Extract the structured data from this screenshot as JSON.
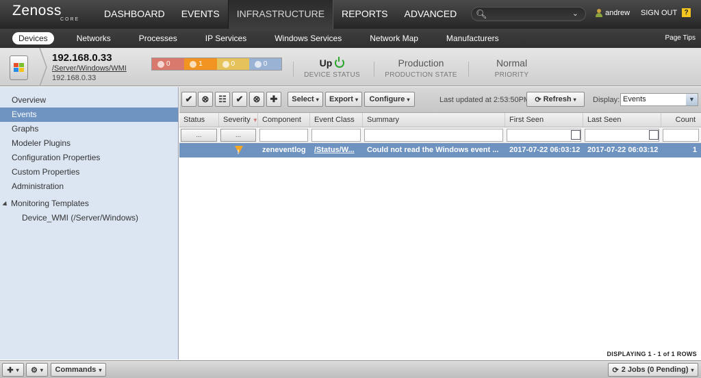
{
  "brand": {
    "name": "Zenoss",
    "sub": "CORE"
  },
  "nav": [
    {
      "label": "DASHBOARD",
      "active": false
    },
    {
      "label": "EVENTS",
      "active": false
    },
    {
      "label": "INFRASTRUCTURE",
      "active": true
    },
    {
      "label": "REPORTS",
      "active": false
    },
    {
      "label": "ADVANCED",
      "active": false
    }
  ],
  "user": {
    "name": "andrew",
    "signout": "SIGN OUT",
    "help": "?"
  },
  "subnav": {
    "items": [
      "Devices",
      "Networks",
      "Processes",
      "IP Services",
      "Windows Services",
      "Network Map",
      "Manufacturers"
    ],
    "active": "Devices",
    "page_tips": "Page Tips"
  },
  "device": {
    "ip": "192.168.0.33",
    "path": "/Server/Windows/WMI",
    "ip2": "192.168.0.33",
    "severity": [
      {
        "count": "0",
        "color": "#d9796e"
      },
      {
        "count": "1",
        "color": "#f29421"
      },
      {
        "count": "0",
        "color": "#e6c35a"
      },
      {
        "count": "0",
        "color": "#9ab3d4"
      }
    ],
    "status": {
      "value": "Up",
      "label": "DEVICE STATUS"
    },
    "production": {
      "value": "Production",
      "label": "PRODUCTION STATE"
    },
    "priority": {
      "value": "Normal",
      "label": "PRIORITY"
    }
  },
  "left_menu": {
    "items": [
      "Overview",
      "Events",
      "Graphs",
      "Modeler Plugins",
      "Configuration Properties",
      "Custom Properties",
      "Administration"
    ],
    "active": "Events",
    "tree_root": "Monitoring Templates",
    "tree_child": "Device_WMI (/Server/Windows)"
  },
  "toolbar": {
    "select": "Select",
    "export": "Export",
    "configure": "Configure",
    "last_updated": "Last updated at 2:53:50PM",
    "refresh": "Refresh",
    "display_label": "Display:",
    "display_value": "Events",
    "dots": "..."
  },
  "table": {
    "columns": [
      "Status",
      "Severity",
      "Component",
      "Event Class",
      "Summary",
      "First Seen",
      "Last Seen",
      "Count"
    ],
    "rows": [
      {
        "status": "",
        "severity": "warning",
        "component": "zeneventlog",
        "event_class": "/Status/W...",
        "summary": "Could not read the Windows event ...",
        "first_seen": "2017-07-22 06:03:12",
        "last_seen": "2017-07-22 06:03:12",
        "count": "1"
      }
    ],
    "footer": "DISPLAYING 1 - 1 of 1 ROWS"
  },
  "bottom": {
    "commands": "Commands",
    "jobs": "2 Jobs (0 Pending)"
  }
}
